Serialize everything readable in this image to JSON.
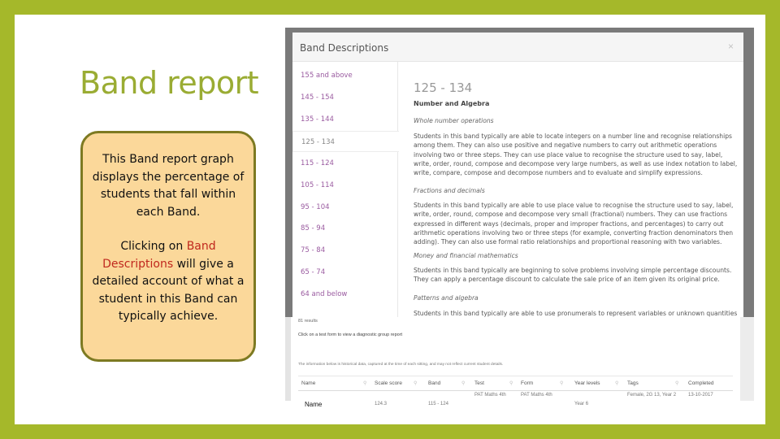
{
  "slide": {
    "title": "Band report",
    "callout": {
      "para1": "This Band report graph displays the percentage of students that fall within each Band.",
      "para2_pre": "Clicking on ",
      "para2_highlight": "Band Descriptions",
      "para2_post": " will give a detailed account of what a student in this Band can typically achieve.",
      "highlight_color": "#c0281e"
    }
  },
  "colors": {
    "frame": "#a5b82a",
    "title": "#9aac33",
    "callout_fill": "#fbd89a",
    "callout_border": "#7d7a22",
    "band_link": "#9a5ba0"
  },
  "modal": {
    "title": "Band Descriptions",
    "close_label": "×",
    "bands": [
      "155 and above",
      "145 - 154",
      "135 - 144",
      "125 - 134",
      "115 - 124",
      "105 - 114",
      "95 - 104",
      "85 - 94",
      "75 - 84",
      "65 - 74",
      "64 and below"
    ],
    "active_band": "125 - 134",
    "detail": {
      "title": "125 - 134",
      "strand": "Number and Algebra",
      "sections": [
        {
          "heading": "Whole number operations",
          "body": "Students in this band typically are able to locate integers on a number line and recognise relationships among them. They can also use positive and negative numbers to carry out arithmetic operations involving two or three steps. They can use place value to recognise the structure used to say, label, write, order, round, compose and decompose very large numbers, as well as use index notation to label, write, compare, compose and decompose numbers and to evaluate and simplify expressions."
        },
        {
          "heading": "Fractions and decimals",
          "body": "Students in this band typically are able to use place value to recognise the structure used to say, label, write, order, round, compose and decompose very small (fractional) numbers. They can use fractions expressed in different ways (decimals, proper and improper fractions, and percentages) to carry out arithmetic operations involving two or three steps (for example, converting fraction denominators then adding). They can also use formal ratio relationships and proportional reasoning with two variables."
        },
        {
          "heading": "Money and financial mathematics",
          "body": "Students in this band typically are beginning to solve problems involving simple percentage discounts. They can apply a percentage discount to calculate the sale price of an item given its original price."
        },
        {
          "heading": "Patterns and algebra",
          "body": "Students in this band typically are able to use pronumerals to represent variables or unknown quantities"
        }
      ]
    }
  },
  "report": {
    "results_count": "81 results",
    "click_hint": "Click on a test form to view a diagnostic group report",
    "info_note": "The information below is historical data, captured at the time of each sitting, and may not reflect current student details.",
    "columns": [
      "Name",
      "Scale score",
      "Band",
      "Test",
      "Form",
      "Year levels",
      "Tags",
      "Completed"
    ],
    "row": {
      "name": "Name",
      "scale_score": "124.3",
      "band": "115 - 124",
      "test": "PAT Maths 4th",
      "form": "PAT Maths 4th",
      "year_levels": "Year 6",
      "tags": "Female, 2G 13, Year 2",
      "completed": "13-10-2017"
    }
  }
}
